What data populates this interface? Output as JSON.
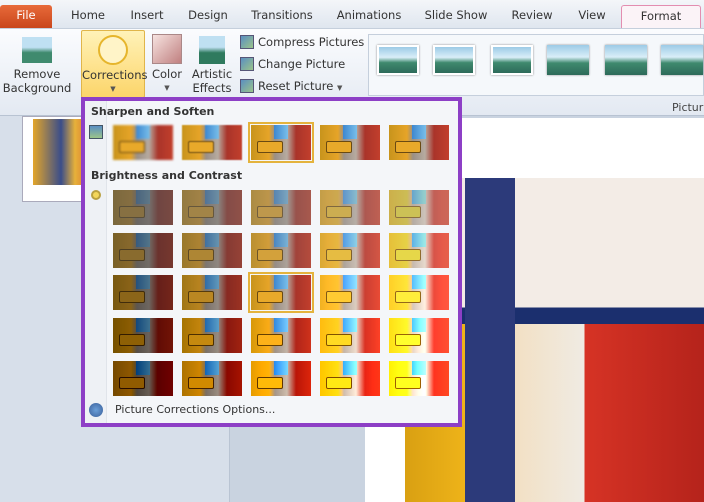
{
  "tabs": [
    "File",
    "Home",
    "Insert",
    "Design",
    "Transitions",
    "Animations",
    "Slide Show",
    "Review",
    "View",
    "Format"
  ],
  "active_tab": "Format",
  "ribbon": {
    "remove_background": [
      "Remove",
      "Background"
    ],
    "corrections": "Corrections",
    "color": "Color",
    "artistic_effects": [
      "Artistic",
      "Effects"
    ],
    "compress": "Compress Pictures",
    "change": "Change Picture",
    "reset": "Reset Picture",
    "group_label": "Pictur"
  },
  "menu": {
    "sharpen_title": "Sharpen and Soften",
    "brightness_title": "Brightness and Contrast",
    "options_label": "Picture Corrections Options...",
    "sharpen_selected": 2,
    "brightness_selected": [
      2,
      2
    ],
    "sharpen_levels": [
      -50,
      -25,
      0,
      25,
      50
    ],
    "brightness_levels": [
      -40,
      -20,
      0,
      20,
      40
    ],
    "contrast_levels": [
      -40,
      -20,
      0,
      20,
      40
    ]
  },
  "colors": {
    "highlight_border": "#8d3fc6",
    "selected_outline": "#e4b33d",
    "file_tab": "#d9552a"
  }
}
